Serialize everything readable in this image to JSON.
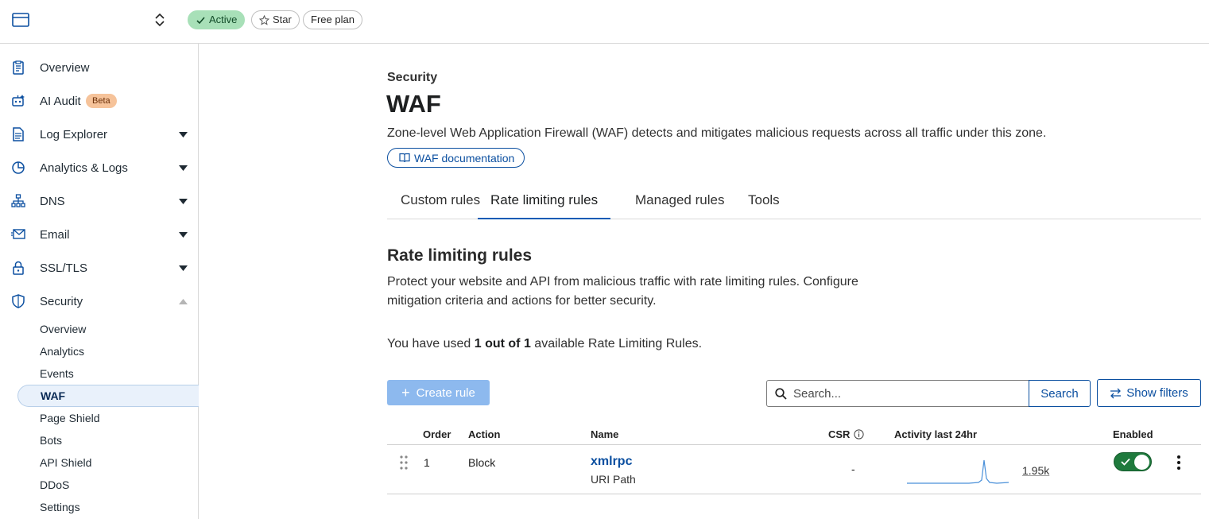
{
  "topbar": {
    "status": "Active",
    "star": "Star",
    "plan": "Free plan"
  },
  "sidebar": {
    "items": [
      {
        "label": "Overview",
        "icon": "clipboard-icon"
      },
      {
        "label": "AI Audit",
        "icon": "robot-icon",
        "badge": "Beta"
      },
      {
        "label": "Log Explorer",
        "icon": "log-icon"
      },
      {
        "label": "Analytics & Logs",
        "icon": "pie-chart-icon"
      },
      {
        "label": "DNS",
        "icon": "network-icon"
      },
      {
        "label": "Email",
        "icon": "email-icon"
      },
      {
        "label": "SSL/TLS",
        "icon": "lock-icon"
      },
      {
        "label": "Security",
        "icon": "shield-icon"
      }
    ],
    "security_sub": [
      "Overview",
      "Analytics",
      "Events",
      "WAF",
      "Page Shield",
      "Bots",
      "API Shield",
      "DDoS",
      "Settings"
    ]
  },
  "main": {
    "crumb": "Security",
    "title": "WAF",
    "description": "Zone-level Web Application Firewall (WAF) detects and mitigates malicious requests across all traffic under this zone.",
    "doc_link": "WAF documentation",
    "tabs": [
      "Custom rules",
      "Rate limiting rules",
      "Managed rules",
      "Tools"
    ],
    "section_title": "Rate limiting rules",
    "section_desc": "Protect your website and API from malicious traffic with rate limiting rules. Configure mitigation criteria and actions for better security.",
    "usage_prefix": "You have used ",
    "usage_bold": "1 out of 1",
    "usage_suffix": " available Rate Limiting Rules.",
    "create_rule": "Create rule",
    "search_placeholder": "Search...",
    "search_button": "Search",
    "filters_button": "Show filters"
  },
  "table": {
    "headers": [
      "Order",
      "Action",
      "Name",
      "CSR",
      "Activity last 24hr",
      "Enabled"
    ],
    "rows": [
      {
        "order": "1",
        "action": "Block",
        "name": "xmlrpc",
        "sub": "URI Path",
        "csr": "-",
        "activity": "1.95k",
        "enabled": true
      }
    ]
  },
  "colors": {
    "accent": "#0b4fa0",
    "active_pill": "#a8e0b8",
    "toggle_on": "#1f7a3d",
    "beta_badge": "#f6c39a",
    "create_disabled": "#8db9ee"
  }
}
